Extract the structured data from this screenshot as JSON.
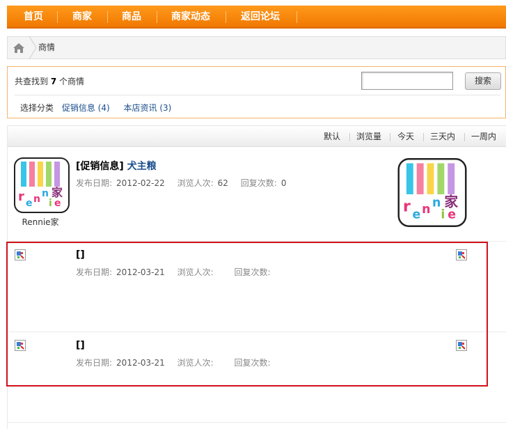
{
  "nav": {
    "items": [
      "首页",
      "商家",
      "商品",
      "商家动态",
      "返回论坛"
    ]
  },
  "breadcrumb": {
    "current": "商情"
  },
  "search": {
    "found_prefix": "共查找到",
    "found_count": "7",
    "found_suffix": "个商情",
    "input_value": "",
    "button_label": "搜索",
    "categories_label": "选择分类",
    "categories": [
      "促销信息 (4)",
      "本店资讯 (3)"
    ]
  },
  "sort": {
    "options": [
      "默认",
      "浏览量",
      "今天",
      "三天内",
      "一周内"
    ]
  },
  "entries": [
    {
      "tag": "[促销信息]",
      "title": "犬主粮",
      "date_label": "发布日期:",
      "date": "2012-02-22",
      "views_label": "浏览人次:",
      "views": "62",
      "replies_label": "回复次数:",
      "replies": "0",
      "shop_name": "Rennie家",
      "logo_text": "rennie家"
    },
    {
      "title": "[]",
      "date_label": "发布日期:",
      "date": "2012-03-21",
      "views_label": "浏览人次:",
      "replies_label": "回复次数:"
    },
    {
      "title": "[]",
      "date_label": "发布日期:",
      "date": "2012-03-21",
      "views_label": "浏览人次:",
      "replies_label": "回复次数:"
    }
  ],
  "colors": {
    "nav_orange": "#f28300",
    "link_blue": "#1a4d8c",
    "highlight_red": "#d0111b"
  }
}
